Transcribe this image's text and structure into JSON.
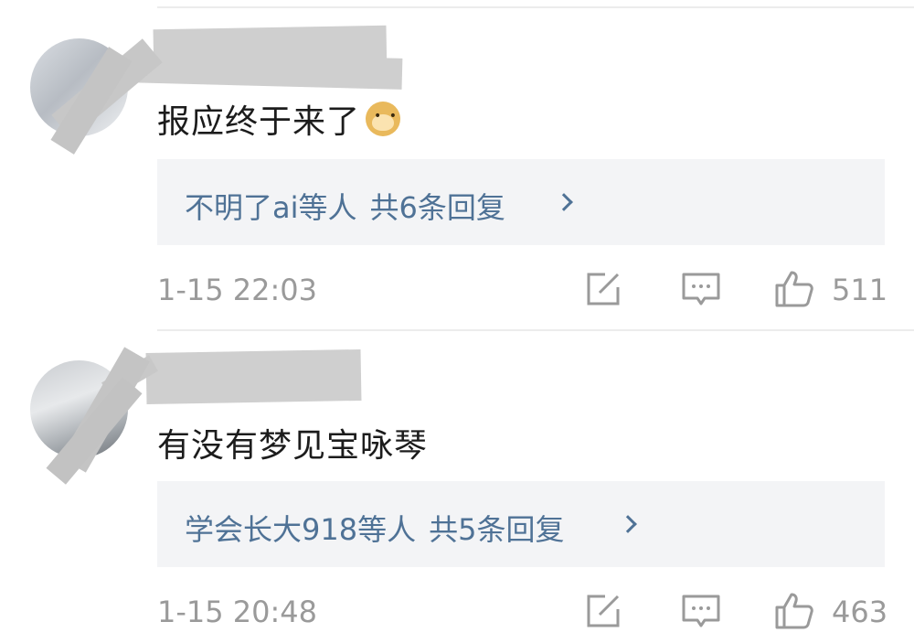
{
  "comments": [
    {
      "text": "报应终于来了",
      "emoji": "doge-emoji",
      "replies": {
        "users": "不明了ai等人",
        "count": "共6条回复"
      },
      "time": "1-15 22:03",
      "likes": "511"
    },
    {
      "text": "有没有梦见宝咏琴",
      "replies": {
        "users": "学会长大918等人",
        "count": "共5条回复"
      },
      "time": "1-15 20:48",
      "likes": "463"
    }
  ],
  "icons": {
    "share": "share-edit-icon",
    "comment": "comment-bubble-icon",
    "like": "thumbs-up-icon",
    "more": "chevron-right-icon"
  },
  "colors": {
    "reply_link": "#4f7296",
    "meta_text": "#9a9a9a",
    "reply_box_bg": "#f3f4f6"
  }
}
